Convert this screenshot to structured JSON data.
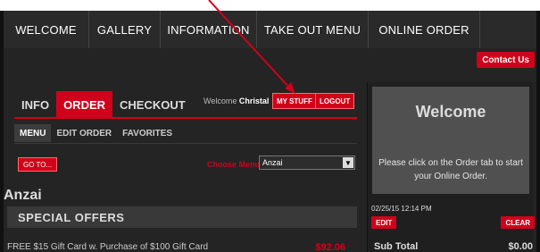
{
  "nav": {
    "items": [
      "WELCOME",
      "GALLERY",
      "INFORMATION",
      "TAKE OUT MENU",
      "ONLINE ORDER"
    ]
  },
  "contact_label": "Contact Us",
  "tabs": {
    "info": "INFO",
    "order": "ORDER",
    "checkout": "CHECKOUT"
  },
  "user": {
    "welcome_prefix": "Welcome",
    "name": "Christal"
  },
  "buttons": {
    "mystuff": "MY STUFF",
    "logout": "LOGOUT",
    "goto": "GO TO...",
    "edit": "EDIT",
    "clear": "CLEAR"
  },
  "subtabs": [
    "MENU",
    "EDIT ORDER",
    "FAVORITES"
  ],
  "menu": {
    "choose_label": "Choose Menu:",
    "selected": "Anzai"
  },
  "section": {
    "title": "Anzai",
    "special": "SPECIAL OFFERS",
    "gift": "FREE $15 Gift Card w. Purchase of $100 Gift Card",
    "price": "$92.06"
  },
  "panel": {
    "title": "Welcome",
    "message": "Please click on the Order tab to start your Online Order.",
    "date": "02/25/15 12:14 PM",
    "subtotal_label": "Sub Total",
    "subtotal_value": "$0.00"
  },
  "colors": {
    "accent": "#d0021b",
    "background": "#1f1f1f"
  }
}
